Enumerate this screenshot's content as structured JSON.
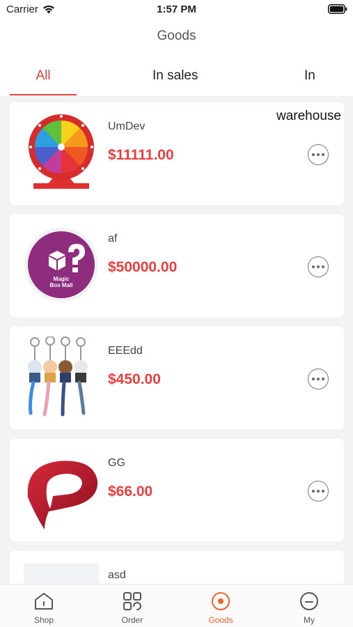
{
  "status": {
    "carrier": "Carrier",
    "time": "1:57 PM"
  },
  "header": {
    "title": "Goods"
  },
  "tabs": [
    {
      "label": "All",
      "active": true
    },
    {
      "label": "In sales",
      "active": false
    },
    {
      "label": "In",
      "active": false
    }
  ],
  "tab_overflow_text": "warehouse",
  "items": [
    {
      "name": "UmDev",
      "price": "$11111.00",
      "image": "prize-wheel-icon"
    },
    {
      "name": "af",
      "price": "$50000.00",
      "image": "magic-box-mall-logo"
    },
    {
      "name": "EEEdd",
      "price": "$450.00",
      "image": "keychain-figures-photo"
    },
    {
      "name": "GG",
      "price": "$66.00",
      "image": "red-p-logo"
    },
    {
      "name": "asd",
      "price": "",
      "image": "placeholder"
    }
  ],
  "logo_text": {
    "line1": "Magic",
    "line2": "Box Mall"
  },
  "nav": [
    {
      "label": "Shop",
      "icon": "shop-icon",
      "active": false
    },
    {
      "label": "Order",
      "icon": "grid-icon",
      "active": false
    },
    {
      "label": "Goods",
      "icon": "goods-target-icon",
      "active": true
    },
    {
      "label": "My",
      "icon": "user-icon",
      "active": false
    }
  ],
  "colors": {
    "accent": "#e8403f",
    "nav_active": "#f0622c",
    "background": "#f3f3f3"
  }
}
